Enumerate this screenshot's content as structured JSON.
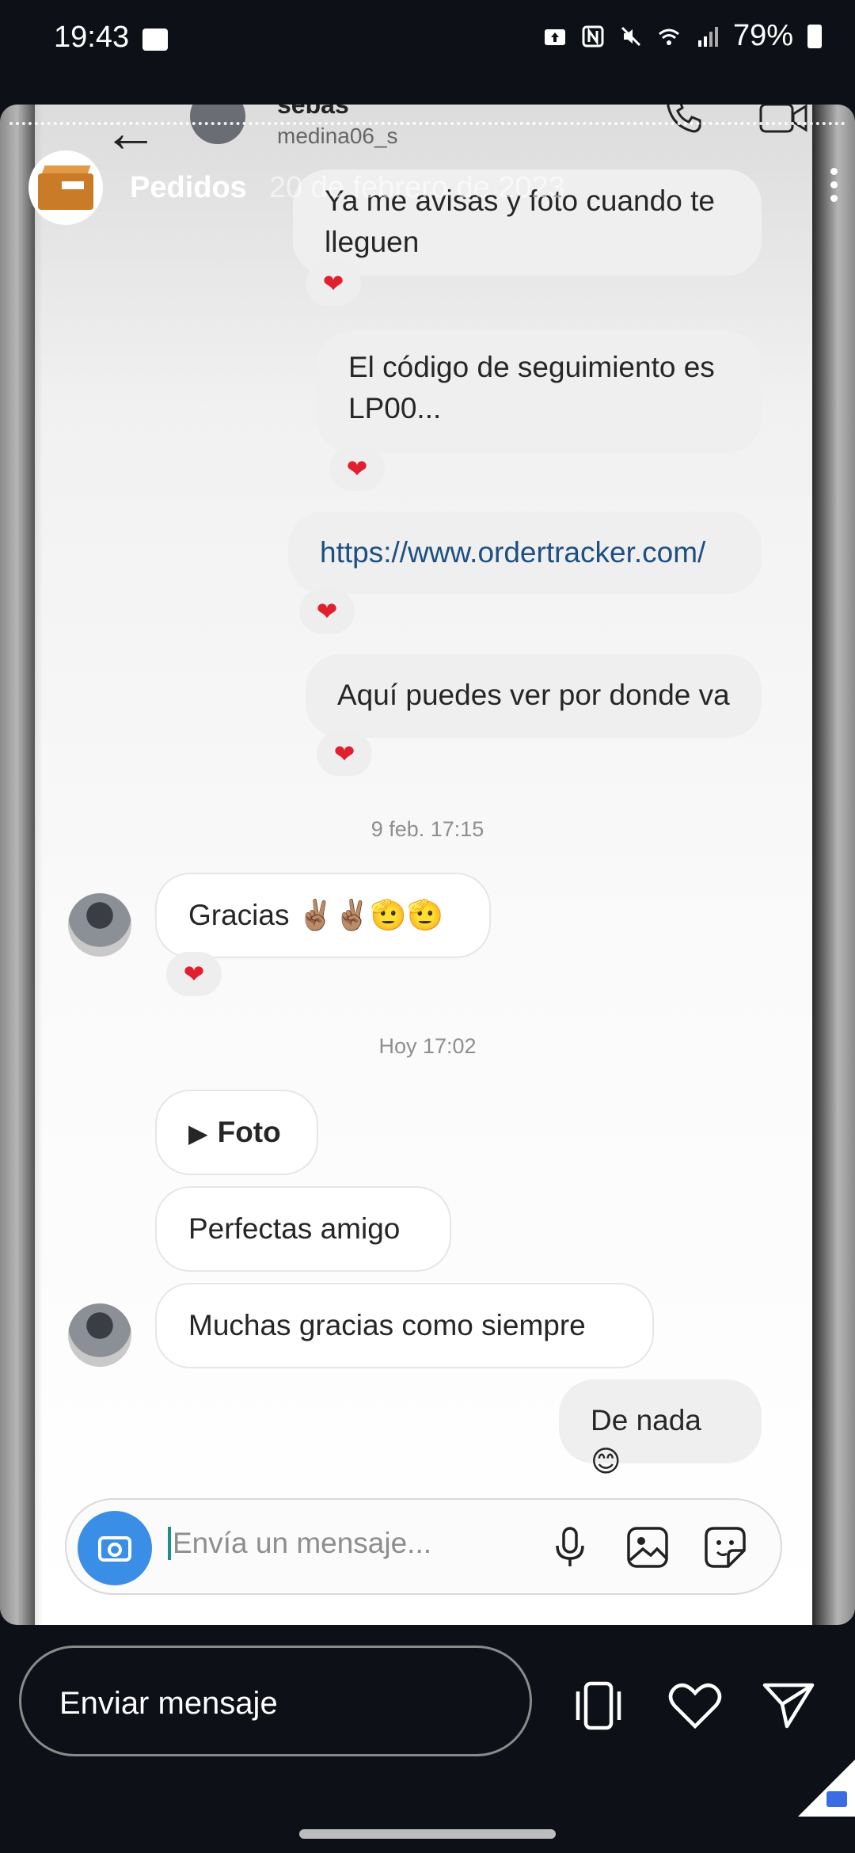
{
  "status_bar": {
    "time": "19:43",
    "battery": "79%"
  },
  "story": {
    "user": "Pedidos",
    "date": "20 de febrero de 2023"
  },
  "dm": {
    "name": "sebas",
    "handle": "medina06_s"
  },
  "messages": [
    {
      "text": "Ya me avisas y foto cuando te lleguen",
      "reaction": "❤"
    },
    {
      "text": "El código de seguimiento es LP00...",
      "reaction": "❤"
    },
    {
      "text": "https://www.ordertracker.com/",
      "reaction": "❤"
    },
    {
      "text": "Aquí puedes ver por donde va",
      "reaction": "❤"
    },
    {
      "time": "9 feb. 17:15"
    },
    {
      "text": "Gracias ✌🏽✌🏽🫡🫡",
      "reaction": "❤"
    },
    {
      "time": "Hoy 17:02"
    },
    {
      "text": "Foto"
    },
    {
      "text": "Perfectas amigo"
    },
    {
      "text": "Muchas gracias como siempre"
    },
    {
      "text": "De nada 😊"
    }
  ],
  "composer": {
    "placeholder": "Envía un mensaje..."
  },
  "reply": {
    "label": "Enviar mensaje"
  },
  "colors": {
    "heart": "#e0202f",
    "link": "#1d4f82",
    "camera": "#3a8ee6"
  }
}
